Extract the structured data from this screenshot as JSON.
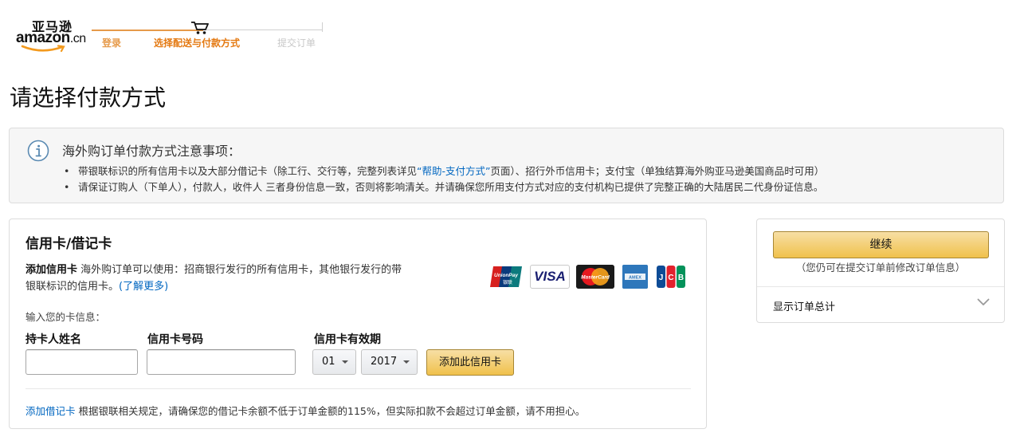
{
  "header": {
    "logo_cn": "亚马逊",
    "logo_en": "amazon",
    "logo_suffix": ".cn",
    "steps": [
      {
        "label": "登录",
        "state": "done"
      },
      {
        "label": "选择配送与付款方式",
        "state": "current"
      },
      {
        "label": "提交订单",
        "state": "todo"
      }
    ],
    "cart_icon": "cart-icon"
  },
  "page": {
    "title": "请选择付款方式"
  },
  "notice": {
    "icon": "info-icon",
    "title": "海外购订单付款方式注意事项：",
    "item1_before": "带银联标识的所有信用卡以及大部分借记卡（除工行、交行等，完整列表详见",
    "item1_link": "“帮助-支付方式”",
    "item1_after": "页面）、招行外币信用卡；支付宝（单独结算海外购亚马逊美国商品时可用）",
    "item2": "请保证订购人（下单人），付款人，收件人 三者身份信息一致，否则将影响清关。并请确保您所用支付方式对应的支付机构已提供了完整正确的大陆居民二代身份证信息。"
  },
  "card_panel": {
    "title": "信用卡/借记卡",
    "desc_bold": "添加信用卡",
    "desc_text": " 海外购订单可以使用：招商银行发行的所有信用卡，其他银行发行的带银联标识的信用卡。",
    "desc_link": "(了解更多)",
    "card_logos": [
      "UnionPay",
      "VISA",
      "MasterCard",
      "American Express",
      "JCB"
    ],
    "visa_text": "VISA",
    "input_label": "输入您的卡信息：",
    "fields": {
      "name_label": "持卡人姓名",
      "name_value": "",
      "number_label": "信用卡号码",
      "number_value": "",
      "expiry_label": "信用卡有效期",
      "month_value": "01",
      "year_value": "2017"
    },
    "add_card_button": "添加此信用卡",
    "debit_link": "添加借记卡",
    "debit_text": " 根据银联相关规定，请确保您的借记卡余额不低于订单金额的115%，但实际扣款不会超过订单金额，请不用担心。"
  },
  "summary": {
    "continue_button": "继续",
    "continue_note": "（您仍可在提交订单前修改订单信息）",
    "toggle_label": "显示订单总计",
    "toggle_icon": "chevron-down-icon"
  },
  "colors": {
    "progress_done": "#e69a4a",
    "progress_current": "#e47911",
    "link": "#0066c0",
    "button_yellow": "#f0c14b",
    "button_border": "#a88734"
  }
}
